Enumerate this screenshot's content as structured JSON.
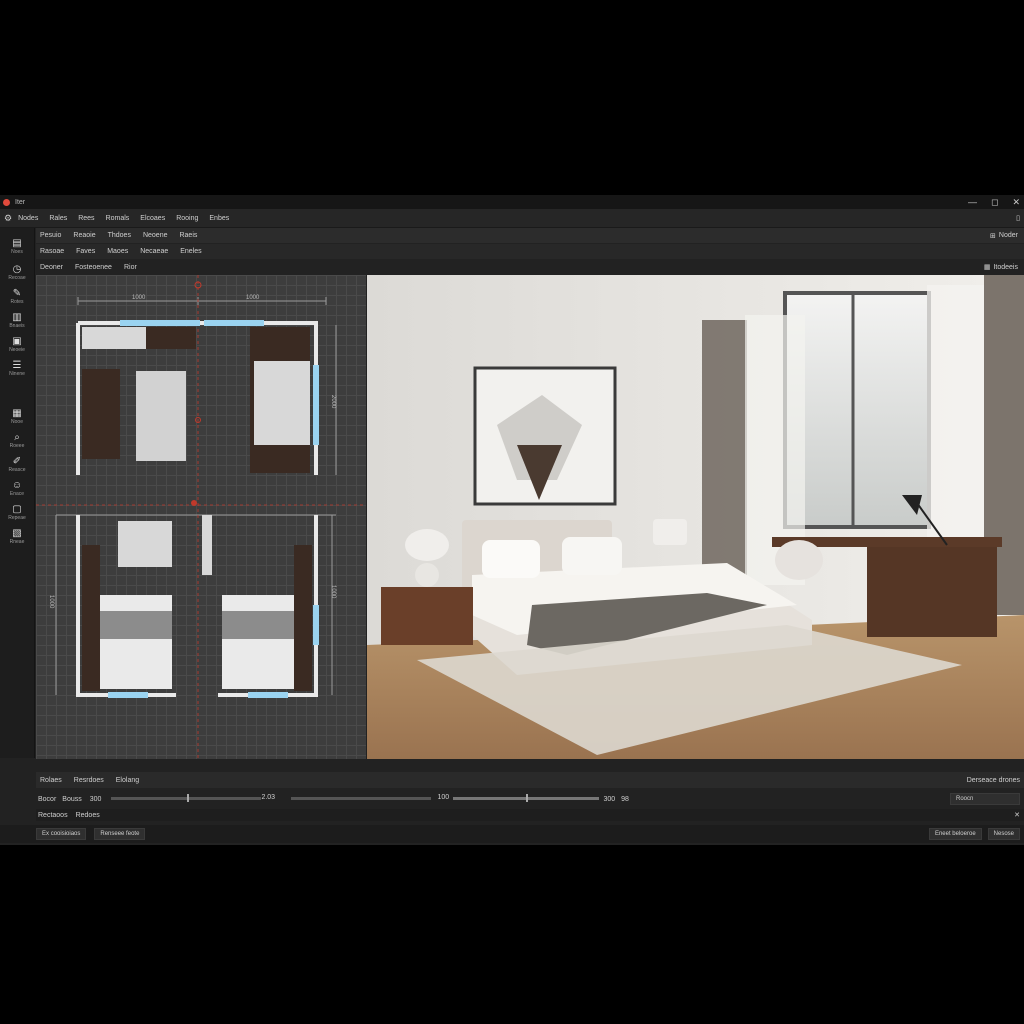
{
  "window": {
    "title": "Iter",
    "controls": [
      "—",
      "◻",
      "✕"
    ]
  },
  "menu": {
    "items": [
      "Nodes",
      "Rales",
      "Rees",
      "Romals",
      "Elcoaes",
      "Rooing",
      "Enbes"
    ]
  },
  "toolbar1": {
    "items": [
      "Pesuio",
      "Reaoie",
      "Thdoes",
      "Neoene",
      "Raeis"
    ],
    "right_label": "Noder"
  },
  "toolbar2": {
    "items": [
      "Rasoae",
      "Faves",
      "Maoes",
      "Necaeae",
      "Eneles"
    ]
  },
  "toolbar3": {
    "items": [
      "Deoner",
      "Fosteoenee",
      "Rior"
    ],
    "right_label": "Itodeeis"
  },
  "rail": {
    "items": [
      "Noes",
      "Recoae",
      "Rotes",
      "Bnaeis",
      "Neoeie",
      "Ninene",
      "Nooe",
      "Roeee",
      "Reasce",
      "Enace",
      "Repeae",
      "Rneae"
    ]
  },
  "plan": {
    "dimensions": [
      "1000",
      "1000",
      "2000",
      "1000",
      "1000"
    ]
  },
  "bottom": {
    "tabs": [
      "Rolaes",
      "Resrdoes",
      "Elolang"
    ],
    "right_label": "Derseace drones",
    "slider": {
      "label_a": "Bocor",
      "label_b": "Bouss",
      "v1": "300",
      "v2": "2.03",
      "v3": "100",
      "v4": "300",
      "v5": "98",
      "right_field": "Roocn"
    },
    "row2": {
      "a": "Rectaoos",
      "b": "Redoes"
    }
  },
  "status": {
    "left_icon": "Ex",
    "left": "cooisioiaos",
    "mid": "Renseee feote",
    "right1": "Eneet beloeroe",
    "right2": "Nesose"
  },
  "colors": {
    "bg": "#222222",
    "accent_red": "#e04a3c",
    "window_blue": "#9ad3f0",
    "furniture": "#3a2a22"
  }
}
